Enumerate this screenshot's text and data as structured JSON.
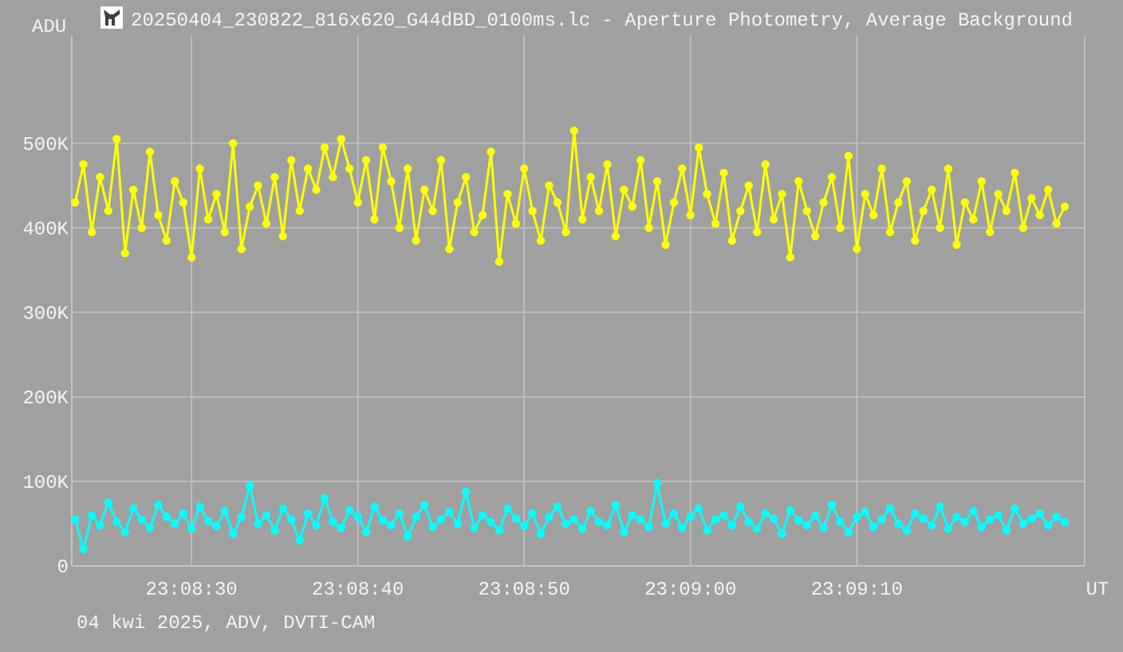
{
  "chart_data": {
    "type": "line",
    "title": "20250404_230822_816x620_G44dBD_0100ms.lc - Aperture Photometry, Average Background",
    "ylabel": "ADU",
    "xlabel": "UT",
    "ylim": [
      0,
      628
    ],
    "grid": true,
    "categories": [
      null,
      null,
      null,
      null,
      null,
      null,
      null,
      null,
      null,
      null,
      null,
      null,
      null,
      null,
      "23:08:30",
      null,
      null,
      null,
      null,
      null,
      null,
      null,
      null,
      null,
      null,
      null,
      null,
      null,
      null,
      null,
      null,
      null,
      null,
      null,
      "23:08:40",
      null,
      null,
      null,
      null,
      null,
      null,
      null,
      null,
      null,
      null,
      null,
      null,
      null,
      null,
      null,
      null,
      null,
      null,
      null,
      "23:08:50",
      null,
      null,
      null,
      null,
      null,
      null,
      null,
      null,
      null,
      null,
      null,
      null,
      null,
      null,
      null,
      null,
      null,
      null,
      null,
      "23:09:00",
      null,
      null,
      null,
      null,
      null,
      null,
      null,
      null,
      null,
      null,
      null,
      null,
      null,
      null,
      null,
      null,
      null,
      null,
      null,
      "23:09:10",
      null,
      null,
      null,
      null,
      null,
      null,
      null,
      null,
      null,
      null,
      null,
      null,
      null,
      null,
      null,
      null,
      null,
      null,
      null,
      null,
      null,
      null,
      null,
      null,
      null
    ],
    "yticks": [
      {
        "value": 0,
        "label": "0"
      },
      {
        "value": 100,
        "label": "100K"
      },
      {
        "value": 200,
        "label": "200K"
      },
      {
        "value": 300,
        "label": "300K"
      },
      {
        "value": 400,
        "label": "400K"
      },
      {
        "value": 500,
        "label": "500K"
      }
    ],
    "series": [
      {
        "color": "#ffff00",
        "marker": "circle",
        "values": [
          430,
          475,
          395,
          460,
          420,
          505,
          370,
          445,
          400,
          490,
          415,
          385,
          455,
          430,
          365,
          470,
          410,
          440,
          395,
          500,
          375,
          425,
          450,
          405,
          460,
          390,
          480,
          420,
          470,
          445,
          495,
          460,
          505,
          470,
          430,
          480,
          410,
          495,
          455,
          400,
          470,
          385,
          445,
          420,
          480,
          375,
          430,
          460,
          395,
          415,
          490,
          360,
          440,
          405,
          470,
          420,
          385,
          450,
          430,
          395,
          515,
          410,
          460,
          420,
          475,
          390,
          445,
          425,
          480,
          400,
          455,
          380,
          430,
          470,
          415,
          495,
          440,
          405,
          465,
          385,
          420,
          450,
          395,
          475,
          410,
          440,
          365,
          455,
          420,
          390,
          430,
          460,
          400,
          485,
          375,
          440,
          415,
          470,
          395,
          430,
          455,
          385,
          420,
          445,
          400,
          470,
          380,
          430,
          410,
          455,
          395,
          440,
          420,
          465,
          400,
          435,
          415,
          445,
          405,
          425
        ]
      },
      {
        "color": "#00ffff",
        "marker": "circle",
        "values": [
          55,
          20,
          60,
          48,
          75,
          52,
          40,
          68,
          55,
          45,
          72,
          58,
          50,
          62,
          44,
          70,
          53,
          47,
          65,
          38,
          58,
          95,
          50,
          60,
          42,
          68,
          55,
          30,
          62,
          48,
          80,
          52,
          45,
          66,
          58,
          40,
          70,
          54,
          48,
          62,
          35,
          58,
          72,
          46,
          55,
          64,
          50,
          88,
          45,
          60,
          52,
          42,
          68,
          56,
          47,
          62,
          38,
          58,
          70,
          50,
          55,
          44,
          65,
          52,
          48,
          72,
          40,
          60,
          55,
          46,
          98,
          50,
          62,
          45,
          58,
          68,
          42,
          55,
          60,
          48,
          70,
          52,
          44,
          62,
          56,
          38,
          66,
          54,
          48,
          60,
          45,
          72,
          52,
          40,
          58,
          64,
          46,
          55,
          68,
          50,
          42,
          62,
          56,
          48,
          70,
          44,
          58,
          52,
          65,
          46,
          55,
          60,
          42,
          68,
          50,
          56,
          62,
          48,
          58,
          52
        ]
      }
    ]
  },
  "footer": "04 kwi 2025, ADV, DVTI-CAM"
}
